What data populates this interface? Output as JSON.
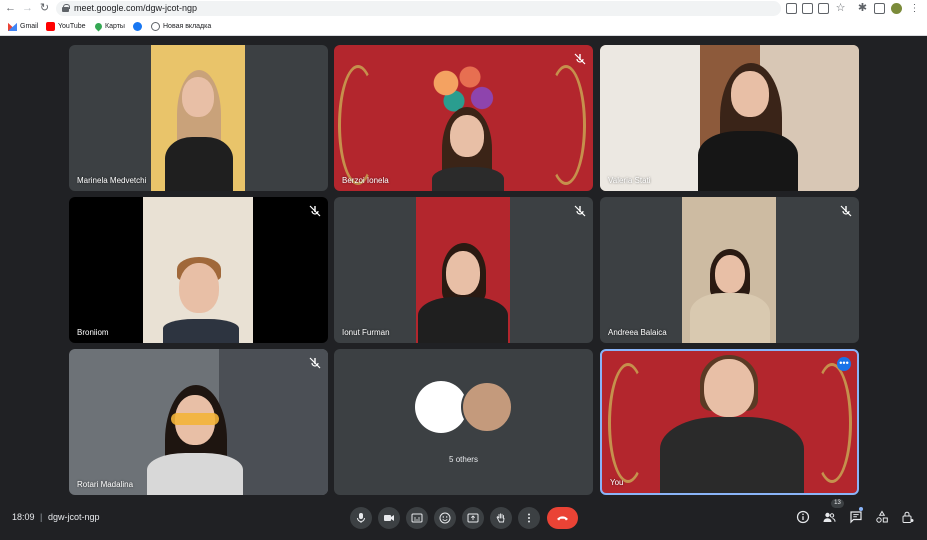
{
  "browser": {
    "url": "meet.google.com/dgw-jcot-ngp",
    "bookmarks": [
      {
        "label": "Gmail",
        "icon": "gmail-icon"
      },
      {
        "label": "YouTube",
        "icon": "youtube-icon"
      },
      {
        "label": "Карты",
        "icon": "maps-icon"
      },
      {
        "label": "",
        "icon": "facebook-icon"
      },
      {
        "label": "Новая вкладка",
        "icon": "globe-icon"
      }
    ]
  },
  "meeting": {
    "time": "18:09",
    "separator": "|",
    "code": "dgw-jcot-ngp",
    "participants_count": "13",
    "accent": "#1a73e8",
    "end_call_color": "#ea4335"
  },
  "tiles": [
    {
      "name": "Marinela Medvetchi",
      "muted": false
    },
    {
      "name": "Berzoi Ionela",
      "muted": true
    },
    {
      "name": "Valeria Stati",
      "muted": false
    },
    {
      "name": "Broniiom",
      "muted": true
    },
    {
      "name": "Ionut Furman",
      "muted": true
    },
    {
      "name": "Andreea Balaica",
      "muted": true
    },
    {
      "name": "Rotari Madalina",
      "muted": true
    },
    {
      "name": "5 others",
      "muted": false
    },
    {
      "name": "You",
      "muted": false
    }
  ]
}
